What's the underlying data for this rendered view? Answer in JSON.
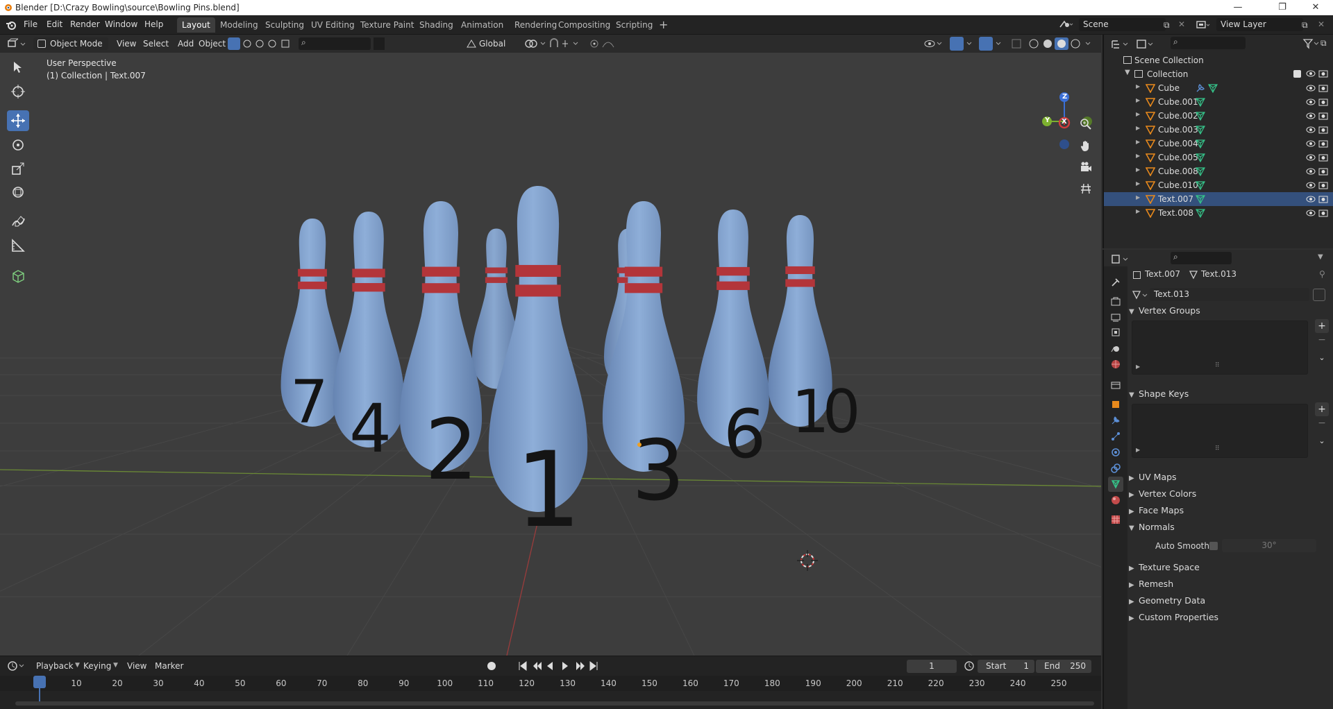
{
  "window": {
    "title": "Blender [D:\\Crazy Bowling\\source\\Bowling Pins.blend]"
  },
  "menu": {
    "items": [
      "File",
      "Edit",
      "Render",
      "Window",
      "Help"
    ]
  },
  "workspaces": {
    "tabs": [
      "Layout",
      "Modeling",
      "Sculpting",
      "UV Editing",
      "Texture Paint",
      "Shading",
      "Animation",
      "Rendering",
      "Compositing",
      "Scripting"
    ],
    "active": "Layout",
    "add": "+"
  },
  "scene": {
    "name": "Scene",
    "view_layer": "View Layer"
  },
  "viewport": {
    "mode": "Object Mode",
    "menus": [
      "View",
      "Select",
      "Add",
      "Object"
    ],
    "orientation": "Global",
    "info_line1": "User Perspective",
    "info_line2": "(1) Collection | Text.007",
    "gizmo_labels": {
      "x": "X",
      "y": "Y",
      "z": "Z"
    },
    "pins": [
      {
        "number": "7"
      },
      {
        "number": "4"
      },
      {
        "number": "2"
      },
      {
        "number": "1"
      },
      {
        "number": "3"
      },
      {
        "number": "6"
      },
      {
        "number": "10"
      }
    ],
    "colors": {
      "pin": "#7e9ecb",
      "stripe": "#b3353a",
      "grid": "#4a4a4a",
      "x_axis": "#8f3d3d",
      "y_axis": "#7a9b3a",
      "accent": "#4772b3"
    }
  },
  "timeline": {
    "menus": [
      "Playback",
      "Keying",
      "View",
      "Marker"
    ],
    "current_frame": "1",
    "start_label": "Start",
    "start": "1",
    "end_label": "End",
    "end": "250",
    "ruler": [
      "1",
      "10",
      "20",
      "30",
      "40",
      "50",
      "60",
      "70",
      "80",
      "90",
      "100",
      "110",
      "120",
      "130",
      "140",
      "150",
      "160",
      "170",
      "180",
      "190",
      "200",
      "210",
      "220",
      "230",
      "240",
      "250"
    ]
  },
  "outliner": {
    "scene_collection": "Scene Collection",
    "collection": "Collection",
    "objects": [
      {
        "name": "Cube",
        "selected": false
      },
      {
        "name": "Cube.001",
        "selected": false
      },
      {
        "name": "Cube.002",
        "selected": false
      },
      {
        "name": "Cube.003",
        "selected": false
      },
      {
        "name": "Cube.004",
        "selected": false
      },
      {
        "name": "Cube.005",
        "selected": false
      },
      {
        "name": "Cube.008",
        "selected": false
      },
      {
        "name": "Cube.010",
        "selected": false
      },
      {
        "name": "Text.007",
        "selected": true
      },
      {
        "name": "Text.008",
        "selected": false
      }
    ]
  },
  "properties": {
    "object": "Text.007",
    "data": "Text.013",
    "datablock": "Text.013",
    "sections": {
      "vertex_groups": "Vertex Groups",
      "shape_keys": "Shape Keys",
      "uv_maps": "UV Maps",
      "vertex_colors": "Vertex Colors",
      "face_maps": "Face Maps",
      "normals": "Normals",
      "texture_space": "Texture Space",
      "remesh": "Remesh",
      "geometry_data": "Geometry Data",
      "custom_properties": "Custom Properties"
    },
    "auto_smooth_label": "Auto Smooth",
    "auto_smooth_angle": "30°"
  }
}
